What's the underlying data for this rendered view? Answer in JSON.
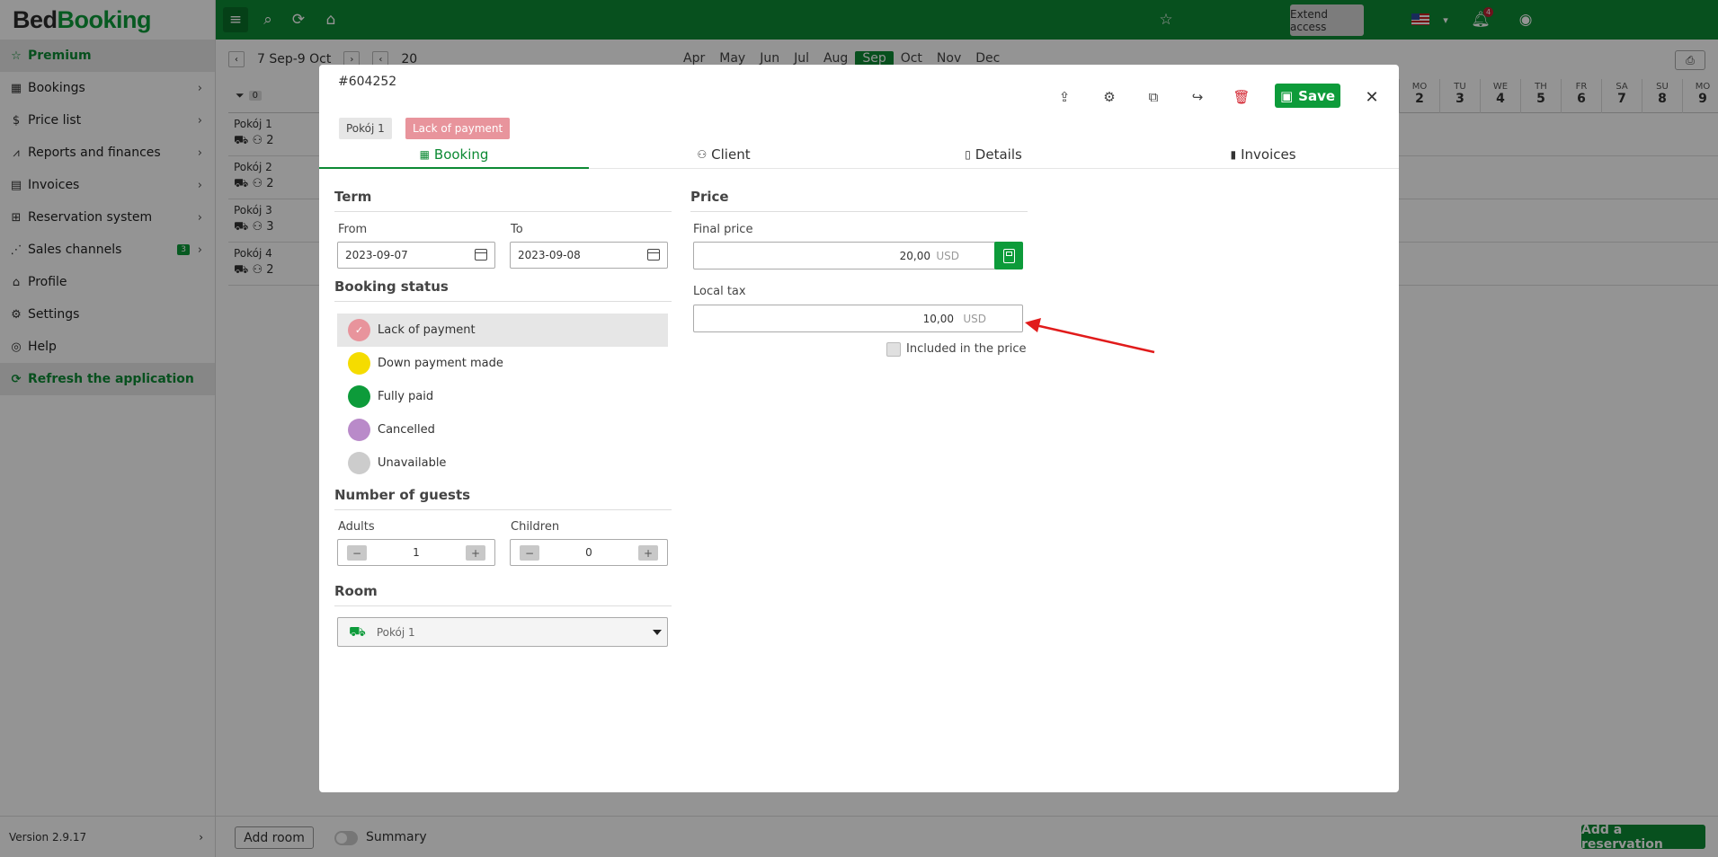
{
  "sidebar": {
    "logo": {
      "bed": "Bed",
      "booking": "Booking"
    },
    "items": [
      {
        "label": "Premium",
        "icon": "star-icon"
      },
      {
        "label": "Bookings",
        "icon": "calendar-icon"
      },
      {
        "label": "Price list",
        "icon": "dollar-icon"
      },
      {
        "label": "Reports and finances",
        "icon": "chart-icon"
      },
      {
        "label": "Invoices",
        "icon": "invoice-icon"
      },
      {
        "label": "Reservation system",
        "icon": "grid-icon"
      },
      {
        "label": "Sales channels",
        "icon": "share-icon",
        "badge": "3"
      },
      {
        "label": "Profile",
        "icon": "building-icon"
      },
      {
        "label": "Settings",
        "icon": "gear-icon"
      },
      {
        "label": "Help",
        "icon": "help-icon"
      },
      {
        "label": "Refresh the application",
        "icon": "refresh-icon"
      }
    ],
    "version": "Version 2.9.17"
  },
  "topbar": {
    "extend_access": "Extend access",
    "notifications": "4"
  },
  "calendar": {
    "range": "7 Sep-9 Oct",
    "year_prefix": "20",
    "months": [
      "Apr",
      "May",
      "Jun",
      "Jul",
      "Aug",
      "Sep",
      "Oct",
      "Nov",
      "Dec"
    ],
    "selected_month": "Sep",
    "filter_count": "0",
    "days": [
      {
        "dow": "MO",
        "num": "2"
      },
      {
        "dow": "TU",
        "num": "3"
      },
      {
        "dow": "WE",
        "num": "4"
      },
      {
        "dow": "TH",
        "num": "5"
      },
      {
        "dow": "FR",
        "num": "6"
      },
      {
        "dow": "SA",
        "num": "7"
      },
      {
        "dow": "SU",
        "num": "8"
      },
      {
        "dow": "MO",
        "num": "9"
      }
    ],
    "rooms": [
      {
        "name": "Pokój 1",
        "guests": "2"
      },
      {
        "name": "Pokój 2",
        "guests": "2"
      },
      {
        "name": "Pokój 3",
        "guests": "3"
      },
      {
        "name": "Pokój 4",
        "guests": "2"
      }
    ],
    "add_room": "Add room",
    "summary": "Summary",
    "add_reservation": "Add a reservation"
  },
  "modal": {
    "booking_id": "#604252",
    "room_chip": "Pokój 1",
    "status_chip": "Lack of payment",
    "save_label": "Save",
    "tabs": [
      {
        "label": "Booking",
        "icon": "calendar-icon",
        "active": true
      },
      {
        "label": "Client",
        "icon": "user-icon"
      },
      {
        "label": "Details",
        "icon": "document-icon"
      },
      {
        "label": "Invoices",
        "icon": "invoice-icon"
      }
    ],
    "term": {
      "title": "Term",
      "from_label": "From",
      "from_value": "2023-09-07",
      "to_label": "To",
      "to_value": "2023-09-08"
    },
    "booking_status": {
      "title": "Booking status",
      "options": [
        {
          "label": "Lack of payment",
          "color": "#e8949c",
          "selected": true
        },
        {
          "label": "Down payment made",
          "color": "#f5dc00"
        },
        {
          "label": "Fully paid",
          "color": "#0d9b3a"
        },
        {
          "label": "Cancelled",
          "color": "#b98ac9"
        },
        {
          "label": "Unavailable",
          "color": "#cccccc"
        }
      ]
    },
    "guests": {
      "title": "Number of guests",
      "adults_label": "Adults",
      "adults_value": "1",
      "children_label": "Children",
      "children_value": "0",
      "minus": "−",
      "plus": "+"
    },
    "room": {
      "title": "Room",
      "selected": "Pokój 1"
    },
    "price": {
      "title": "Price",
      "final_label": "Final price",
      "final_value": "20,00",
      "final_currency": "USD",
      "tax_label": "Local tax",
      "tax_value": "10,00",
      "tax_currency": "USD",
      "included_label": "Included in the price",
      "included_checked": false
    }
  },
  "colors": {
    "brand_green": "#0d8a34",
    "delete_red": "#d21f2b",
    "annotation_arrow": "#e11b1b"
  }
}
